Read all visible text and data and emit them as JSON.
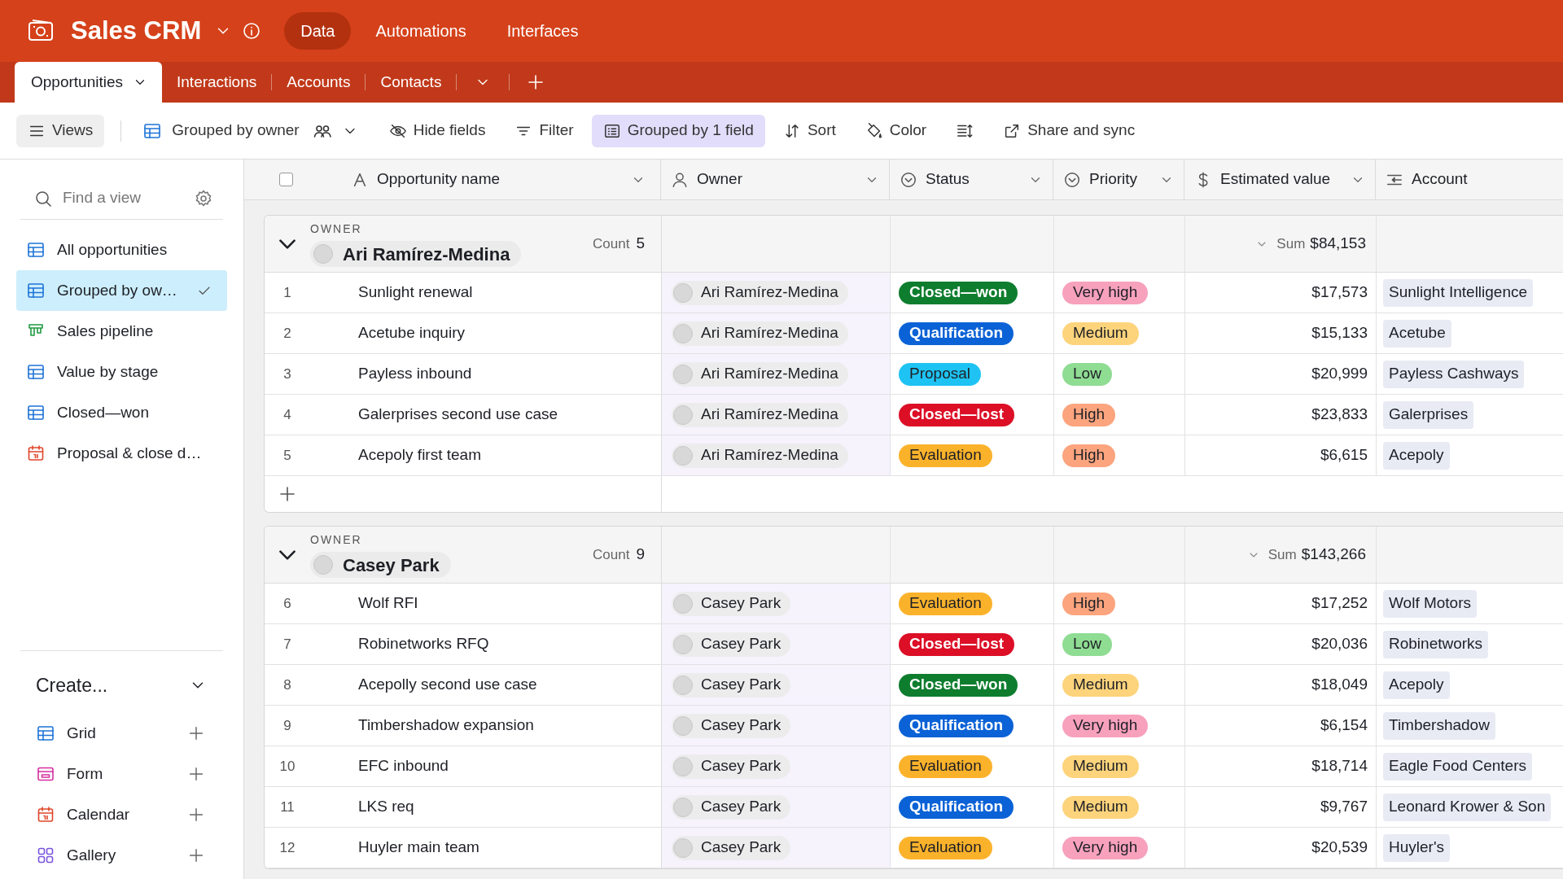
{
  "app": {
    "name": "Sales CRM",
    "nav": [
      {
        "label": "Data",
        "selected": true
      },
      {
        "label": "Automations",
        "selected": false
      },
      {
        "label": "Interfaces",
        "selected": false
      }
    ]
  },
  "table_tabs": [
    {
      "label": "Opportunities",
      "selected": true
    },
    {
      "label": "Interactions",
      "selected": false
    },
    {
      "label": "Accounts",
      "selected": false
    },
    {
      "label": "Contacts",
      "selected": false
    }
  ],
  "toolbar": {
    "views_button": "Views",
    "view_name": "Grouped by owner",
    "items": [
      {
        "kind": "hide",
        "label": "Hide fields",
        "selected": false
      },
      {
        "kind": "filter",
        "label": "Filter",
        "selected": false
      },
      {
        "kind": "group",
        "label": "Grouped by 1 field",
        "selected": true
      },
      {
        "kind": "sort",
        "label": "Sort",
        "selected": false
      },
      {
        "kind": "color",
        "label": "Color",
        "selected": false
      },
      {
        "kind": "rowheight",
        "selected": false
      },
      {
        "kind": "share",
        "label": "Share and sync",
        "selected": false
      }
    ]
  },
  "sidebar": {
    "search": {
      "placeholder": "Find a view"
    },
    "views": [
      {
        "kind": "grid",
        "label": "All opportunities",
        "selected": false
      },
      {
        "kind": "grid",
        "label": "Grouped by ow…",
        "selected": true
      },
      {
        "kind": "kanban",
        "label": "Sales pipeline",
        "selected": false
      },
      {
        "kind": "grid",
        "label": "Value by stage",
        "selected": false
      },
      {
        "kind": "grid",
        "label": "Closed—won",
        "selected": false
      },
      {
        "kind": "calendar",
        "label": "Proposal & close d…",
        "selected": false
      }
    ],
    "create": {
      "title": "Create...",
      "items": [
        {
          "kind": "grid",
          "label": "Grid"
        },
        {
          "kind": "form",
          "label": "Form"
        },
        {
          "kind": "calendar",
          "label": "Calendar"
        },
        {
          "kind": "gallery",
          "label": "Gallery"
        }
      ]
    }
  },
  "grid": {
    "select_all_checked": false,
    "columns": [
      {
        "kind": "text",
        "label": "Opportunity name"
      },
      {
        "kind": "user",
        "label": "Owner"
      },
      {
        "kind": "status",
        "label": "Status"
      },
      {
        "kind": "status",
        "label": "Priority"
      },
      {
        "kind": "currency",
        "label": "Estimated value"
      },
      {
        "kind": "link",
        "label": "Account"
      }
    ],
    "groups": [
      {
        "field_label": "OWNER",
        "owner": "Ari Ramírez-Medina",
        "expanded": true,
        "count_label": "Count",
        "count": "5",
        "sum_label": "Sum",
        "sum": "$84,153",
        "rows": [
          {
            "number": "1",
            "name": "Sunlight renewal",
            "owner": "Ari Ramírez-Medina",
            "status": {
              "label": "Closed—won",
              "color": "#0e7d2e"
            },
            "priority": {
              "label": "Very high",
              "color": "#f7a1bd"
            },
            "value": "$17,573",
            "account": "Sunlight Intelligence"
          },
          {
            "number": "2",
            "name": "Acetube inquiry",
            "owner": "Ari Ramírez-Medina",
            "status": {
              "label": "Qualification",
              "color": "#0b62d6"
            },
            "priority": {
              "label": "Medium",
              "color": "#fdd47c"
            },
            "value": "$15,133",
            "account": "Acetube"
          },
          {
            "number": "3",
            "name": "Payless inbound",
            "owner": "Ari Ramírez-Medina",
            "status": {
              "label": "Proposal",
              "color": "#1ec3f3"
            },
            "priority": {
              "label": "Low",
              "color": "#8fdc93"
            },
            "value": "$20,999",
            "account": "Payless Cashways"
          },
          {
            "number": "4",
            "name": "Galerprises second use case",
            "owner": "Ari Ramírez-Medina",
            "status": {
              "label": "Closed—lost",
              "color": "#dc0f26"
            },
            "priority": {
              "label": "High",
              "color": "#fba47e"
            },
            "value": "$23,833",
            "account": "Galerprises"
          },
          {
            "number": "5",
            "name": "Acepoly first team",
            "owner": "Ari Ramírez-Medina",
            "status": {
              "label": "Evaluation",
              "color": "#fbb22b"
            },
            "priority": {
              "label": "High",
              "color": "#fba47e"
            },
            "value": "$6,615",
            "account": "Acepoly"
          }
        ]
      },
      {
        "field_label": "OWNER",
        "owner": "Casey Park",
        "expanded": true,
        "count_label": "Count",
        "count": "9",
        "sum_label": "Sum",
        "sum": "$143,266",
        "rows": [
          {
            "number": "6",
            "name": "Wolf RFI",
            "owner": "Casey Park",
            "status": {
              "label": "Evaluation",
              "color": "#fbb22b"
            },
            "priority": {
              "label": "High",
              "color": "#fba47e"
            },
            "value": "$17,252",
            "account": "Wolf Motors"
          },
          {
            "number": "7",
            "name": "Robinetworks RFQ",
            "owner": "Casey Park",
            "status": {
              "label": "Closed—lost",
              "color": "#dc0f26"
            },
            "priority": {
              "label": "Low",
              "color": "#8fdc93"
            },
            "value": "$20,036",
            "account": "Robinetworks"
          },
          {
            "number": "8",
            "name": "Acepolly second use case",
            "owner": "Casey Park",
            "status": {
              "label": "Closed—won",
              "color": "#0e7d2e"
            },
            "priority": {
              "label": "Medium",
              "color": "#fdd47c"
            },
            "value": "$18,049",
            "account": "Acepoly"
          },
          {
            "number": "9",
            "name": "Timbershadow expansion",
            "owner": "Casey Park",
            "status": {
              "label": "Qualification",
              "color": "#0b62d6"
            },
            "priority": {
              "label": "Very high",
              "color": "#f7a1bd"
            },
            "value": "$6,154",
            "account": "Timbershadow"
          },
          {
            "number": "10",
            "name": "EFC inbound",
            "owner": "Casey Park",
            "status": {
              "label": "Evaluation",
              "color": "#fbb22b"
            },
            "priority": {
              "label": "Medium",
              "color": "#fdd47c"
            },
            "value": "$18,714",
            "account": "Eagle Food Centers"
          },
          {
            "number": "11",
            "name": "LKS req",
            "owner": "Casey Park",
            "status": {
              "label": "Qualification",
              "color": "#0b62d6"
            },
            "priority": {
              "label": "Medium",
              "color": "#fdd47c"
            },
            "value": "$9,767",
            "account": "Leonard Krower & Son"
          },
          {
            "number": "12",
            "name": "Huyler main team",
            "owner": "Casey Park",
            "status": {
              "label": "Evaluation",
              "color": "#fbb22b"
            },
            "priority": {
              "label": "Very high",
              "color": "#f7a1bd"
            },
            "value": "$20,539",
            "account": "Huyler's"
          }
        ]
      }
    ]
  }
}
